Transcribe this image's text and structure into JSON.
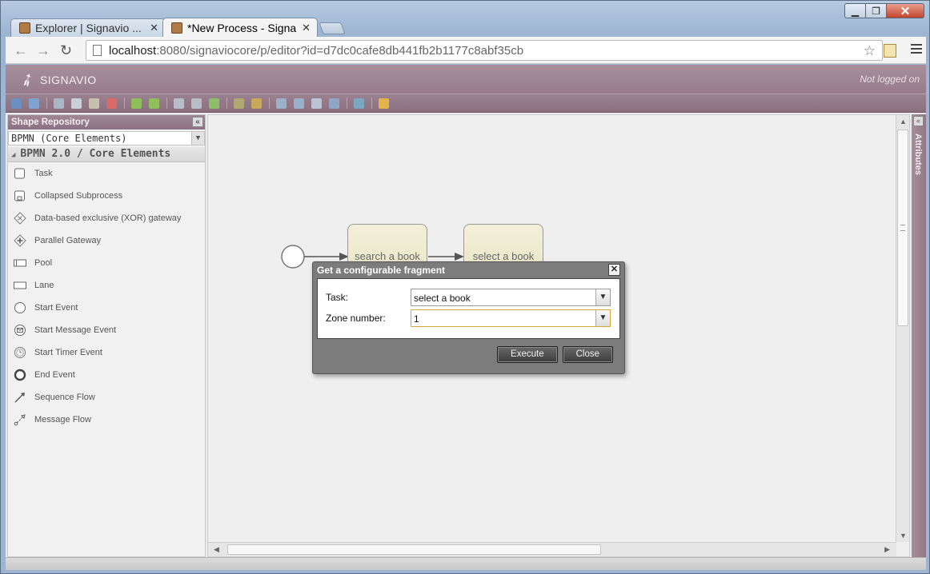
{
  "browser": {
    "tabs": [
      {
        "title": "Explorer | Signavio ...",
        "active": false
      },
      {
        "title": "*New Process - Signa",
        "active": true
      }
    ],
    "url_host": "localhost",
    "url_path": ":8080/signaviocore/p/editor?id=d7dc0cafe8db441fb2b1177c8abf35cb"
  },
  "app": {
    "logo_text": "SIGNAVIO",
    "login_status": "Not logged on",
    "accent_color": "#977c8a"
  },
  "shape_repository": {
    "title": "Shape Repository",
    "selected_stencil": "BPMN (Core Elements)",
    "group": "BPMN 2.0 / Core Elements",
    "items": [
      {
        "label": "Task",
        "icon": "task-icon"
      },
      {
        "label": "Collapsed Subprocess",
        "icon": "subprocess-icon"
      },
      {
        "label": "Data-based exclusive (XOR) gateway",
        "icon": "xor-gateway-icon"
      },
      {
        "label": "Parallel Gateway",
        "icon": "parallel-gateway-icon"
      },
      {
        "label": "Pool",
        "icon": "pool-icon"
      },
      {
        "label": "Lane",
        "icon": "lane-icon"
      },
      {
        "label": "Start Event",
        "icon": "start-event-icon"
      },
      {
        "label": "Start Message Event",
        "icon": "start-message-event-icon"
      },
      {
        "label": "Start Timer Event",
        "icon": "start-timer-event-icon"
      },
      {
        "label": "End Event",
        "icon": "end-event-icon"
      },
      {
        "label": "Sequence Flow",
        "icon": "sequence-flow-icon"
      },
      {
        "label": "Message Flow",
        "icon": "message-flow-icon"
      }
    ]
  },
  "diagram": {
    "tasks": [
      "search a book",
      "select a book"
    ]
  },
  "attributes_panel": {
    "label": "Attributes"
  },
  "dialog": {
    "title": "Get a configurable fragment",
    "task_label": "Task:",
    "task_value": "select a book",
    "zone_label": "Zone number:",
    "zone_value": "1",
    "execute_label": "Execute",
    "close_label": "Close"
  }
}
